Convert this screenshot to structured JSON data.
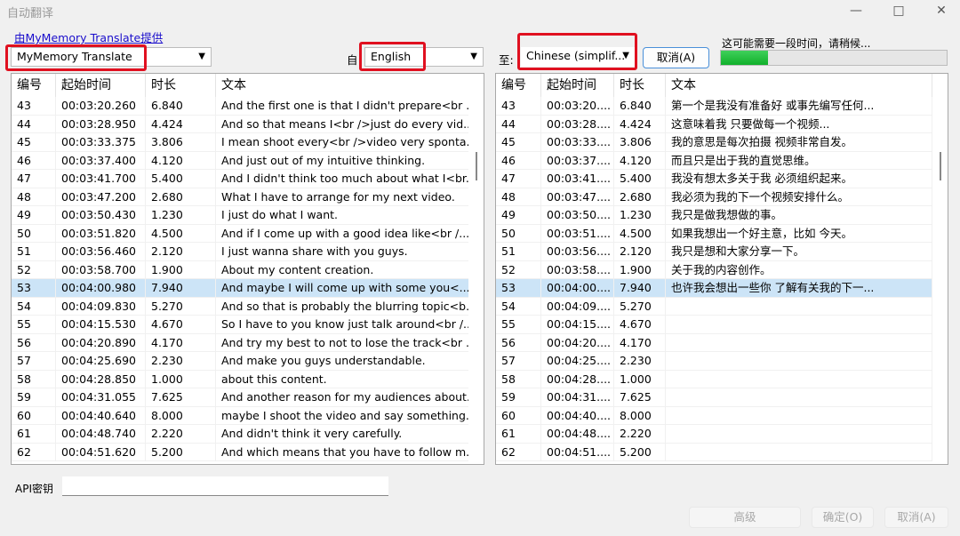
{
  "window": {
    "title": "自动翻译"
  },
  "provider_link": "由MyMemory Translate提供",
  "provider": {
    "value": "MyMemory Translate"
  },
  "from_label": "自",
  "from_lang": {
    "value": "English"
  },
  "to_label": "至:",
  "to_lang": {
    "value": "Chinese (simplif..."
  },
  "cancel_top": "取消(A)",
  "status_text": "这可能需要一段时间，请稍候...",
  "progress_percent": 21,
  "columns": [
    "编号",
    "起始时间",
    "时长",
    "文本"
  ],
  "selected_row": "53",
  "left_rows": [
    [
      "43",
      "00:03:20.260",
      "6.840",
      "And the first one is that I didn't prepare<br ..."
    ],
    [
      "44",
      "00:03:28.950",
      "4.424",
      "And so that means I<br />just do every vid..."
    ],
    [
      "45",
      "00:03:33.375",
      "3.806",
      "I mean shoot every<br />video very sponta..."
    ],
    [
      "46",
      "00:03:37.400",
      "4.120",
      "And just out of my intuitive thinking."
    ],
    [
      "47",
      "00:03:41.700",
      "5.400",
      "And I didn't think too much about what I<br..."
    ],
    [
      "48",
      "00:03:47.200",
      "2.680",
      "What I have to arrange for my next video."
    ],
    [
      "49",
      "00:03:50.430",
      "1.230",
      "I just do what I want."
    ],
    [
      "50",
      "00:03:51.820",
      "4.500",
      "And if I come up with a good idea like<br /..."
    ],
    [
      "51",
      "00:03:56.460",
      "2.120",
      "I just wanna share with you guys."
    ],
    [
      "52",
      "00:03:58.700",
      "1.900",
      "About my content creation."
    ],
    [
      "53",
      "00:04:00.980",
      "7.940",
      "And maybe I will come up with some you<..."
    ],
    [
      "54",
      "00:04:09.830",
      "5.270",
      "And so that is probably the blurring topic<b..."
    ],
    [
      "55",
      "00:04:15.530",
      "4.670",
      "So I have to you know just talk around<br /..."
    ],
    [
      "56",
      "00:04:20.890",
      "4.170",
      "And try my best to not to lose the track<br ..."
    ],
    [
      "57",
      "00:04:25.690",
      "2.230",
      "And make you guys understandable."
    ],
    [
      "58",
      "00:04:28.850",
      "1.000",
      "about this content."
    ],
    [
      "59",
      "00:04:31.055",
      "7.625",
      "And another reason for my audiences about..."
    ],
    [
      "60",
      "00:04:40.640",
      "8.000",
      "maybe I shoot the video and say something..."
    ],
    [
      "61",
      "00:04:48.740",
      "2.220",
      "And didn't think it very carefully."
    ],
    [
      "62",
      "00:04:51.620",
      "5.200",
      "And which means that you have to follow m..."
    ]
  ],
  "right_rows": [
    [
      "43",
      "00:03:20....",
      "6.840",
      "第一个是我没有准备好 或事先编写任何..."
    ],
    [
      "44",
      "00:03:28....",
      "4.424",
      "这意味着我 只要做每一个视频..."
    ],
    [
      "45",
      "00:03:33....",
      "3.806",
      "我的意思是每次拍摄 视频非常自发。"
    ],
    [
      "46",
      "00:03:37....",
      "4.120",
      "而且只是出于我的直觉思维。"
    ],
    [
      "47",
      "00:03:41....",
      "5.400",
      "我没有想太多关于我 必须组织起来。"
    ],
    [
      "48",
      "00:03:47....",
      "2.680",
      "我必须为我的下一个视频安排什么。"
    ],
    [
      "49",
      "00:03:50....",
      "1.230",
      "我只是做我想做的事。"
    ],
    [
      "50",
      "00:03:51....",
      "4.500",
      "如果我想出一个好主意，比如 今天。"
    ],
    [
      "51",
      "00:03:56....",
      "2.120",
      "我只是想和大家分享一下。"
    ],
    [
      "52",
      "00:03:58....",
      "1.900",
      "关于我的内容创作。"
    ],
    [
      "53",
      "00:04:00....",
      "7.940",
      "也许我会想出一些你 了解有关我的下一..."
    ],
    [
      "54",
      "00:04:09....",
      "5.270",
      ""
    ],
    [
      "55",
      "00:04:15....",
      "4.670",
      ""
    ],
    [
      "56",
      "00:04:20....",
      "4.170",
      ""
    ],
    [
      "57",
      "00:04:25....",
      "2.230",
      ""
    ],
    [
      "58",
      "00:04:28....",
      "1.000",
      ""
    ],
    [
      "59",
      "00:04:31....",
      "7.625",
      ""
    ],
    [
      "60",
      "00:04:40....",
      "8.000",
      ""
    ],
    [
      "61",
      "00:04:48....",
      "2.220",
      ""
    ],
    [
      "62",
      "00:04:51....",
      "5.200",
      ""
    ]
  ],
  "api_key": {
    "label": "API密钥",
    "value": ""
  },
  "buttons": {
    "advanced": "高级",
    "ok": "确定(O)",
    "cancel": "取消(A)"
  },
  "colors": {
    "highlight": "#e01020",
    "selection": "#cce4f7",
    "progress": "#22c03a",
    "link": "#1a0dcc"
  }
}
